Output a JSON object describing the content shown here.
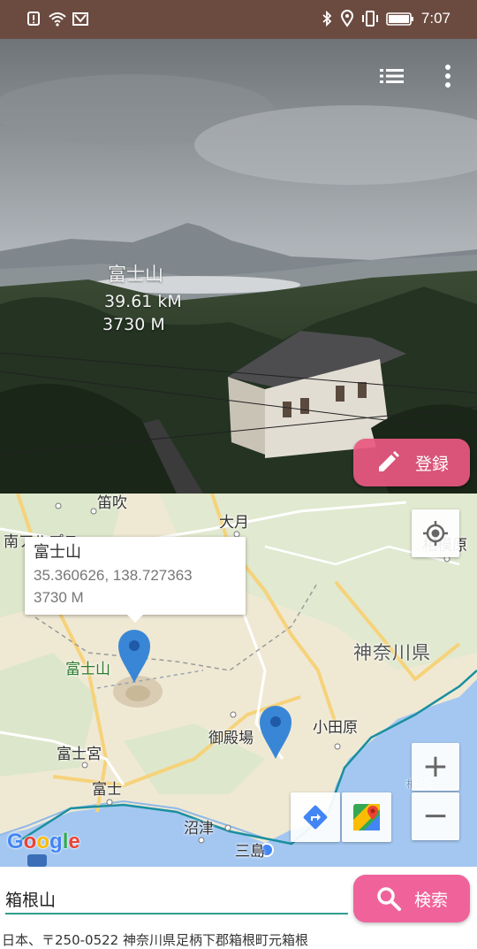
{
  "status_bar": {
    "time": "7:07",
    "icons_left": [
      "alert-icon",
      "wifi-icon",
      "mail-icon"
    ],
    "icons_right": [
      "bluetooth-icon",
      "location-icon",
      "vibrate-icon",
      "battery-icon"
    ]
  },
  "camera": {
    "ar_label": {
      "name": "富士山",
      "distance": "39.61 kM",
      "altitude": "3730 M"
    },
    "register_button": {
      "label": "登録",
      "icon": "pencil-icon"
    },
    "toolbar_icons": [
      "list-icon",
      "overflow-menu-icon"
    ]
  },
  "map": {
    "labels": {
      "fuefuki": "笛吹",
      "minami_alps": "南アルプス",
      "otsuki": "大月",
      "sagamihara": "相模原",
      "kanagawa": "神奈川県",
      "fujisan": "富士山",
      "gotemba": "御殿場",
      "odawara": "小田原",
      "fujinomiya": "富士宮",
      "fuji": "富士",
      "numazu": "沼津",
      "mishima": "三島",
      "sagami_bay": "相模湾"
    },
    "info_window": {
      "title": "富士山",
      "coordinates": "35.360626, 138.727363",
      "altitude": "3730 M"
    },
    "google_logo": "Google",
    "zoom_in": "+",
    "zoom_out": "−"
  },
  "search": {
    "value": "箱根山",
    "button_label": "検索"
  },
  "address": "日本、〒250-0522 神奈川県足柄下郡箱根町元箱根",
  "colors": {
    "status_bar": "#6b4b40",
    "accent_pink": "#f0639a",
    "input_underline": "#2e9d8f",
    "marker_blue": "#3a86d6"
  }
}
